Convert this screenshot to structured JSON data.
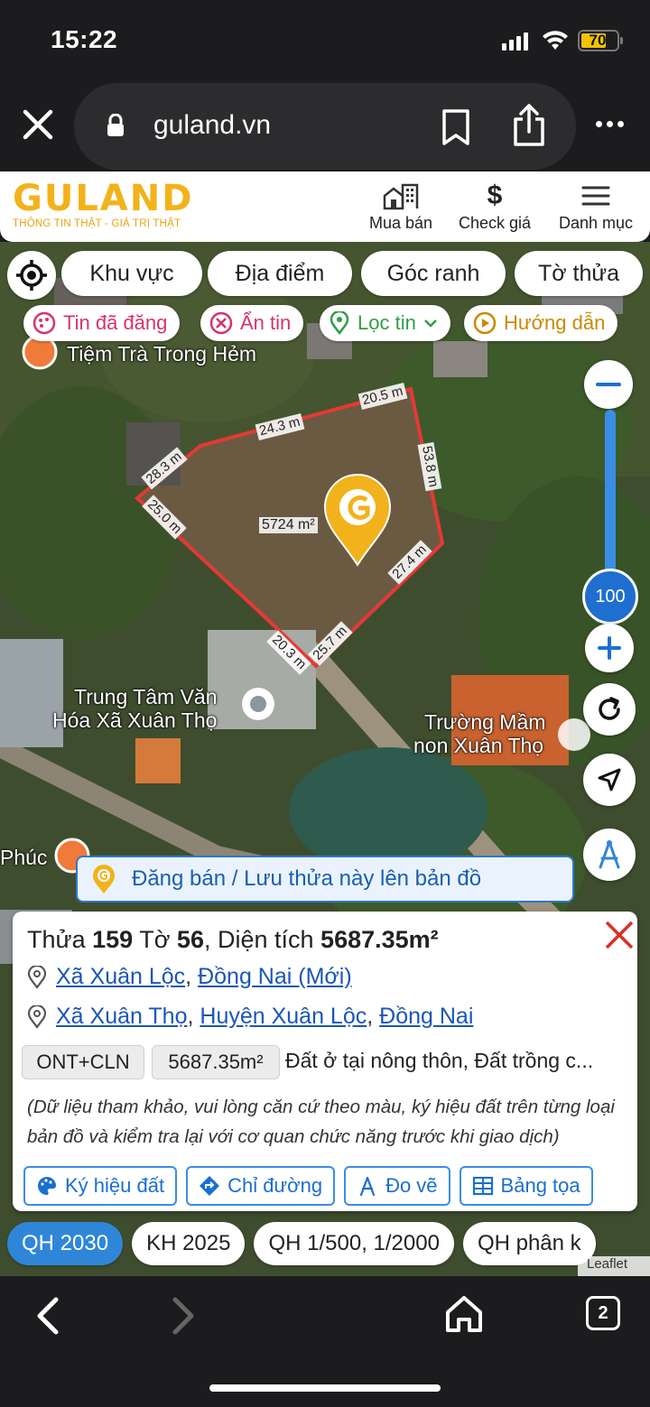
{
  "status_bar": {
    "time": "15:22",
    "battery": "70"
  },
  "browser": {
    "url": "guland.vn"
  },
  "site": {
    "logo_word": "GULAND",
    "logo_tagline": "THÔNG TIN THẬT - GIÁ TRỊ THẬT",
    "nav": [
      {
        "label": "Mua bán",
        "icon": "house-building-icon"
      },
      {
        "label": "Check giá",
        "icon": "dollar-icon"
      },
      {
        "label": "Danh mục",
        "icon": "menu-icon"
      }
    ]
  },
  "filters": {
    "primary": [
      "Khu vực",
      "Địa điểm",
      "Góc ranh",
      "Tờ thửa"
    ],
    "secondary": [
      {
        "label": "Tin đã đăng",
        "color": "#d6336c"
      },
      {
        "label": "Ẩn tin",
        "color": "#d6336c"
      },
      {
        "label": "Lọc tin",
        "color": "#2f9e44"
      },
      {
        "label": "Hướng dẫn",
        "color": "#c98a00"
      }
    ]
  },
  "map": {
    "labels": {
      "tea_shop": "Tiệm Trà Trong Hẻm",
      "culture_center_1": "Trung Tâm Văn",
      "culture_center_2": "Hóa Xã Xuân Thọ",
      "school_1": "Trường Mầm",
      "school_2": "non Xuân Thọ",
      "phuc": "Phúc"
    },
    "measurements": [
      "20.5 m",
      "24.3 m",
      "53.8 m",
      "28.3 m",
      "25.0 m",
      "27.4 m",
      "25.7 m",
      "20.3 m"
    ],
    "area_label": "5724 m²",
    "zoom_level": "100",
    "attribution": "Leaflet"
  },
  "post_bar": {
    "label": "Đăng bán / Lưu thửa này lên bản đồ"
  },
  "parcel": {
    "thua_label": "Thửa",
    "thua": "159",
    "to_label": "Tờ",
    "to": "56",
    "dt_label": ", Diện tích",
    "dien_tich": "5687.35m²",
    "address_new": {
      "commune": "Xã Xuân Lộc",
      "province": "Đồng Nai (Mới)"
    },
    "address_old": {
      "commune": "Xã Xuân Thọ",
      "district": "Huyện Xuân Lộc",
      "province": "Đồng Nai"
    },
    "land_code": "ONT+CLN",
    "land_area": "5687.35m²",
    "land_desc": "Đất ở tại nông thôn, Đất trồng c...",
    "note": "(Dữ liệu tham khảo, vui lòng căn cứ theo màu, ký hiệu đất trên từng loại bản đồ và kiểm tra lại với cơ quan chức năng trước khi giao dịch)",
    "actions": [
      "Ký hiệu đất",
      "Chỉ đường",
      "Đo vẽ",
      "Bảng tọa"
    ]
  },
  "plan_tabs": [
    "QH 2030",
    "KH 2025",
    "QH 1/500, 1/2000",
    "QH phân k"
  ],
  "bottom_bar": {
    "tab_count": "2"
  },
  "colors": {
    "accent_blue": "#2f86d8",
    "brand_yellow": "#f2b21b",
    "parcel_outline": "#e53935"
  }
}
